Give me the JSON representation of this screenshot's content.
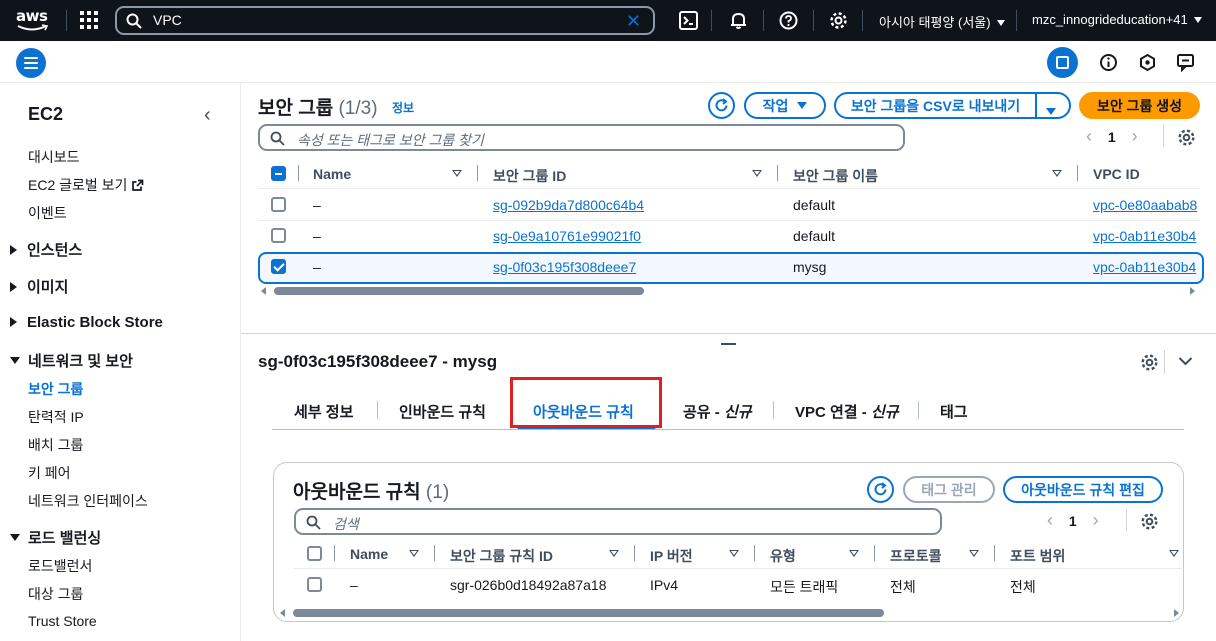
{
  "topnav": {
    "logo_text": "aws",
    "search_value": "VPC",
    "region": "아시아 태평양 (서울)",
    "account": "mzc_innogrideducation+41"
  },
  "sidebar": {
    "title": "EC2",
    "links_top": [
      "대시보드",
      "EC2 글로벌 보기",
      "이벤트"
    ],
    "sections": [
      "인스턴스",
      "이미지",
      "Elastic Block Store",
      "네트워크 및 보안",
      "로드 밸런싱"
    ],
    "network_items": [
      "보안 그룹",
      "탄력적 IP",
      "배치 그룹",
      "키 페어",
      "네트워크 인터페이스"
    ],
    "lb_items": [
      "로드밸런서",
      "대상 그룹",
      "Trust Store"
    ]
  },
  "sg_list": {
    "title": "보안 그룹",
    "count": "(1/3)",
    "info": "정보",
    "actions_label": "작업",
    "export_label": "보안 그룹을 CSV로 내보내기",
    "create_label": "보안 그룹 생성",
    "search_placeholder": "속성 또는 태그로 보안 그룹 찾기",
    "page": "1",
    "columns": [
      "Name",
      "보안 그룹 ID",
      "보안 그룹 이름",
      "VPC ID"
    ],
    "rows": [
      {
        "name": "–",
        "id": "sg-092b9da7d800c64b4",
        "group_name": "default",
        "vpc": "vpc-0e80aabab8"
      },
      {
        "name": "–",
        "id": "sg-0e9a10761e99021f0",
        "group_name": "default",
        "vpc": "vpc-0ab11e30b4"
      },
      {
        "name": "–",
        "id": "sg-0f03c195f308deee7",
        "group_name": "mysg",
        "vpc": "vpc-0ab11e30b4"
      }
    ]
  },
  "detail": {
    "title": "sg-0f03c195f308deee7 - mysg",
    "tabs": [
      "세부 정보",
      "인바운드 규칙",
      "아웃바운드 규칙",
      "공유 - ",
      "신규",
      "VPC 연결 - ",
      "신규",
      "태그"
    ]
  },
  "outbound": {
    "title": "아웃바운드 규칙",
    "count": "(1)",
    "manage_tags": "태그 관리",
    "edit_label": "아웃바운드 규칙 편집",
    "search_placeholder": "검색",
    "page": "1",
    "columns": [
      "Name",
      "보안 그룹 규칙 ID",
      "IP 버전",
      "유형",
      "프로토콜",
      "포트 범위"
    ],
    "rows": [
      {
        "name": "–",
        "rule_id": "sgr-026b0d18492a87a18",
        "ip_version": "IPv4",
        "type": "모든 트래픽",
        "protocol": "전체",
        "port_range": "전체"
      }
    ]
  }
}
